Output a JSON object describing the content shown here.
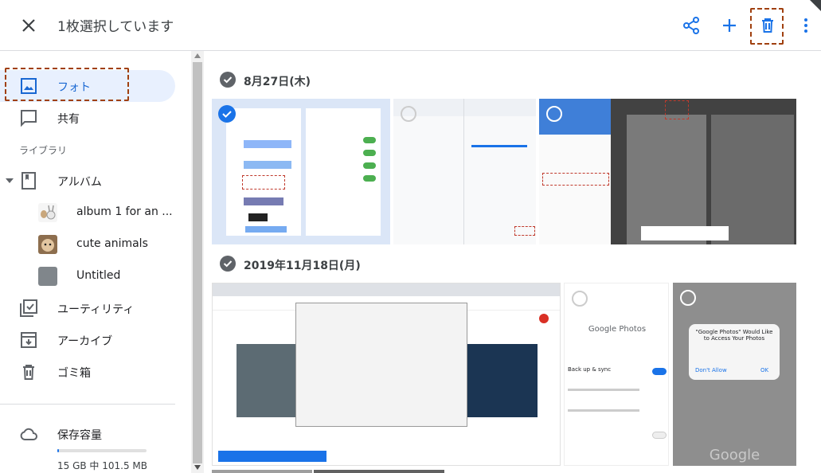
{
  "header": {
    "title": "1枚選択しています"
  },
  "sidebar": {
    "items": [
      {
        "label": "フォト"
      },
      {
        "label": "共有"
      }
    ],
    "library_label": "ライブラリ",
    "albums_label": "アルバム",
    "albums": [
      {
        "label": "album 1 for an ..."
      },
      {
        "label": "cute animals"
      },
      {
        "label": "Untitled"
      }
    ],
    "utilities_label": "ユーティリティ",
    "archive_label": "アーカイブ",
    "trash_label": "ゴミ箱",
    "storage": {
      "label": "保存容量",
      "usage": "15 GB 中 101.5 MB",
      "used_fraction": 0.007
    }
  },
  "content": {
    "groups": [
      {
        "date": "8月27日(木)"
      },
      {
        "date": "2019年11月18日(月)"
      }
    ],
    "photo_texts": {
      "google_photos": "Google Photos",
      "backup_sync": "Back up & sync",
      "would_like": "\"Google Photos\" Would Like to Access Your Photos",
      "dont_allow": "Don't Allow",
      "ok": "OK",
      "google": "Google"
    }
  },
  "colors": {
    "accent": "#1a73e8",
    "highlight_dash": "#a0400f",
    "active_bg": "#e8f0fe"
  }
}
